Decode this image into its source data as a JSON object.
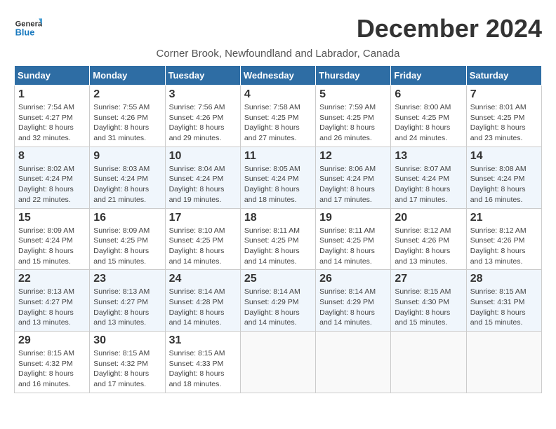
{
  "header": {
    "logo_line1": "General",
    "logo_line2": "Blue",
    "title": "December 2024",
    "subtitle": "Corner Brook, Newfoundland and Labrador, Canada"
  },
  "weekdays": [
    "Sunday",
    "Monday",
    "Tuesday",
    "Wednesday",
    "Thursday",
    "Friday",
    "Saturday"
  ],
  "weeks": [
    [
      {
        "day": "1",
        "sunrise": "Sunrise: 7:54 AM",
        "sunset": "Sunset: 4:27 PM",
        "daylight": "Daylight: 8 hours and 32 minutes."
      },
      {
        "day": "2",
        "sunrise": "Sunrise: 7:55 AM",
        "sunset": "Sunset: 4:26 PM",
        "daylight": "Daylight: 8 hours and 31 minutes."
      },
      {
        "day": "3",
        "sunrise": "Sunrise: 7:56 AM",
        "sunset": "Sunset: 4:26 PM",
        "daylight": "Daylight: 8 hours and 29 minutes."
      },
      {
        "day": "4",
        "sunrise": "Sunrise: 7:58 AM",
        "sunset": "Sunset: 4:25 PM",
        "daylight": "Daylight: 8 hours and 27 minutes."
      },
      {
        "day": "5",
        "sunrise": "Sunrise: 7:59 AM",
        "sunset": "Sunset: 4:25 PM",
        "daylight": "Daylight: 8 hours and 26 minutes."
      },
      {
        "day": "6",
        "sunrise": "Sunrise: 8:00 AM",
        "sunset": "Sunset: 4:25 PM",
        "daylight": "Daylight: 8 hours and 24 minutes."
      },
      {
        "day": "7",
        "sunrise": "Sunrise: 8:01 AM",
        "sunset": "Sunset: 4:25 PM",
        "daylight": "Daylight: 8 hours and 23 minutes."
      }
    ],
    [
      {
        "day": "8",
        "sunrise": "Sunrise: 8:02 AM",
        "sunset": "Sunset: 4:24 PM",
        "daylight": "Daylight: 8 hours and 22 minutes."
      },
      {
        "day": "9",
        "sunrise": "Sunrise: 8:03 AM",
        "sunset": "Sunset: 4:24 PM",
        "daylight": "Daylight: 8 hours and 21 minutes."
      },
      {
        "day": "10",
        "sunrise": "Sunrise: 8:04 AM",
        "sunset": "Sunset: 4:24 PM",
        "daylight": "Daylight: 8 hours and 19 minutes."
      },
      {
        "day": "11",
        "sunrise": "Sunrise: 8:05 AM",
        "sunset": "Sunset: 4:24 PM",
        "daylight": "Daylight: 8 hours and 18 minutes."
      },
      {
        "day": "12",
        "sunrise": "Sunrise: 8:06 AM",
        "sunset": "Sunset: 4:24 PM",
        "daylight": "Daylight: 8 hours and 17 minutes."
      },
      {
        "day": "13",
        "sunrise": "Sunrise: 8:07 AM",
        "sunset": "Sunset: 4:24 PM",
        "daylight": "Daylight: 8 hours and 17 minutes."
      },
      {
        "day": "14",
        "sunrise": "Sunrise: 8:08 AM",
        "sunset": "Sunset: 4:24 PM",
        "daylight": "Daylight: 8 hours and 16 minutes."
      }
    ],
    [
      {
        "day": "15",
        "sunrise": "Sunrise: 8:09 AM",
        "sunset": "Sunset: 4:24 PM",
        "daylight": "Daylight: 8 hours and 15 minutes."
      },
      {
        "day": "16",
        "sunrise": "Sunrise: 8:09 AM",
        "sunset": "Sunset: 4:25 PM",
        "daylight": "Daylight: 8 hours and 15 minutes."
      },
      {
        "day": "17",
        "sunrise": "Sunrise: 8:10 AM",
        "sunset": "Sunset: 4:25 PM",
        "daylight": "Daylight: 8 hours and 14 minutes."
      },
      {
        "day": "18",
        "sunrise": "Sunrise: 8:11 AM",
        "sunset": "Sunset: 4:25 PM",
        "daylight": "Daylight: 8 hours and 14 minutes."
      },
      {
        "day": "19",
        "sunrise": "Sunrise: 8:11 AM",
        "sunset": "Sunset: 4:25 PM",
        "daylight": "Daylight: 8 hours and 14 minutes."
      },
      {
        "day": "20",
        "sunrise": "Sunrise: 8:12 AM",
        "sunset": "Sunset: 4:26 PM",
        "daylight": "Daylight: 8 hours and 13 minutes."
      },
      {
        "day": "21",
        "sunrise": "Sunrise: 8:12 AM",
        "sunset": "Sunset: 4:26 PM",
        "daylight": "Daylight: 8 hours and 13 minutes."
      }
    ],
    [
      {
        "day": "22",
        "sunrise": "Sunrise: 8:13 AM",
        "sunset": "Sunset: 4:27 PM",
        "daylight": "Daylight: 8 hours and 13 minutes."
      },
      {
        "day": "23",
        "sunrise": "Sunrise: 8:13 AM",
        "sunset": "Sunset: 4:27 PM",
        "daylight": "Daylight: 8 hours and 13 minutes."
      },
      {
        "day": "24",
        "sunrise": "Sunrise: 8:14 AM",
        "sunset": "Sunset: 4:28 PM",
        "daylight": "Daylight: 8 hours and 14 minutes."
      },
      {
        "day": "25",
        "sunrise": "Sunrise: 8:14 AM",
        "sunset": "Sunset: 4:29 PM",
        "daylight": "Daylight: 8 hours and 14 minutes."
      },
      {
        "day": "26",
        "sunrise": "Sunrise: 8:14 AM",
        "sunset": "Sunset: 4:29 PM",
        "daylight": "Daylight: 8 hours and 14 minutes."
      },
      {
        "day": "27",
        "sunrise": "Sunrise: 8:15 AM",
        "sunset": "Sunset: 4:30 PM",
        "daylight": "Daylight: 8 hours and 15 minutes."
      },
      {
        "day": "28",
        "sunrise": "Sunrise: 8:15 AM",
        "sunset": "Sunset: 4:31 PM",
        "daylight": "Daylight: 8 hours and 15 minutes."
      }
    ],
    [
      {
        "day": "29",
        "sunrise": "Sunrise: 8:15 AM",
        "sunset": "Sunset: 4:32 PM",
        "daylight": "Daylight: 8 hours and 16 minutes."
      },
      {
        "day": "30",
        "sunrise": "Sunrise: 8:15 AM",
        "sunset": "Sunset: 4:32 PM",
        "daylight": "Daylight: 8 hours and 17 minutes."
      },
      {
        "day": "31",
        "sunrise": "Sunrise: 8:15 AM",
        "sunset": "Sunset: 4:33 PM",
        "daylight": "Daylight: 8 hours and 18 minutes."
      },
      null,
      null,
      null,
      null
    ]
  ]
}
